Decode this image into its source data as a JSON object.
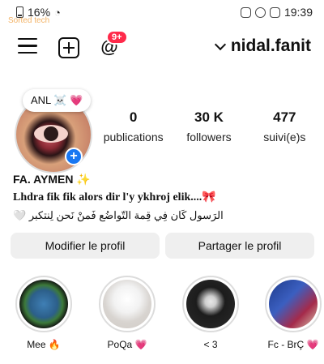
{
  "status_bar": {
    "left_text": "16%",
    "time": "19:39"
  },
  "toolbar": {
    "username": "nidal.fanit",
    "notif_count": "9+"
  },
  "watermark": "Sorted tech",
  "profile": {
    "note_text": "ANL ☠️ 💗",
    "stats": [
      {
        "value": "0",
        "label": "publications"
      },
      {
        "value": "30 K",
        "label": "followers"
      },
      {
        "value": "477",
        "label": "suivi(e)s"
      }
    ],
    "name": "FA. AYMEN ✨",
    "bio_line1": "Lhdra fik fik alors dir l'y ykhroj elik....🎀",
    "bio_line2": "🤍 الرَسول كَان فِي قِمة التّواضُع فَمنْ نَحن لِنتكبر"
  },
  "actions": {
    "edit_label": "Modifier le profil",
    "share_label": "Partager le profil"
  },
  "highlights": [
    {
      "label": "Mee 🔥"
    },
    {
      "label": "PoQa 💗"
    },
    {
      "label": "< 3"
    },
    {
      "label": "Fc - BrÇ 💗"
    }
  ],
  "colors": {
    "badge": "#ff2a4a",
    "add_story": "#1877f2",
    "button_bg": "#efefef"
  }
}
